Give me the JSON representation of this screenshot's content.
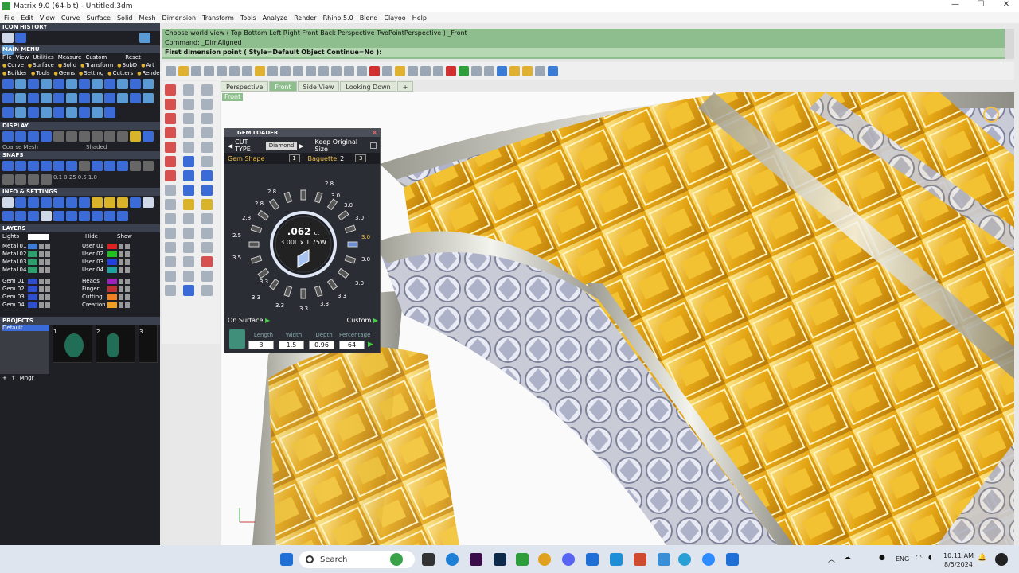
{
  "window": {
    "title": "Matrix 9.0 (64-bit) - Untitled.3dm",
    "controls": [
      "—",
      "☐",
      "✕"
    ]
  },
  "menubar": [
    "File",
    "Edit",
    "View",
    "Curve",
    "Surface",
    "Solid",
    "Mesh",
    "Dimension",
    "Transform",
    "Tools",
    "Analyze",
    "Render",
    "Rhino 5.0",
    "Blend",
    "Clayoo",
    "Help"
  ],
  "left_panel": {
    "icon_history": "ICON HISTORY",
    "main_menu": "MAIN MENU",
    "main_menu_items": [
      "File",
      "View",
      "Utilities",
      "Measure",
      "Custom",
      "Reset"
    ],
    "category_row1": [
      "Curve",
      "Surface",
      "Solid",
      "Transform",
      "SubD",
      "Art"
    ],
    "category_row2": [
      "Builder",
      "Tools",
      "Gems",
      "Setting",
      "Cutters",
      "Render"
    ],
    "display": "DISPLAY",
    "display_modes": [
      "Coarse Mesh",
      "Shaded"
    ],
    "snaps": "SNAPS",
    "snap_values": [
      "0.1",
      "0.25",
      "0.5",
      "1.0"
    ],
    "info_settings": "INFO & SETTINGS",
    "layers": "LAYERS",
    "layer_header": [
      "Lights",
      "Hide",
      "Show"
    ],
    "layers_left": [
      {
        "name": "Metal 01",
        "color": "#3a7bd5"
      },
      {
        "name": "Metal 02",
        "color": "#2e9e6c"
      },
      {
        "name": "Metal 03",
        "color": "#2e9e6c"
      },
      {
        "name": "Metal 04",
        "color": "#2e9e6c"
      },
      {
        "name": "Gem 01",
        "color": "#2f4fd0"
      },
      {
        "name": "Gem 02",
        "color": "#2f4fd0"
      },
      {
        "name": "Gem 03",
        "color": "#2f4fd0"
      },
      {
        "name": "Gem 04",
        "color": "#2f4fd0"
      }
    ],
    "layers_right": [
      {
        "name": "User 01",
        "color": "#e02020"
      },
      {
        "name": "User 02",
        "color": "#20c020"
      },
      {
        "name": "User 03",
        "color": "#2040e0"
      },
      {
        "name": "User 04",
        "color": "#20a0a0"
      },
      {
        "name": "Heads",
        "color": "#a020c0"
      },
      {
        "name": "Finger",
        "color": "#c03030"
      },
      {
        "name": "Cutting",
        "color": "#f08020"
      },
      {
        "name": "Creation",
        "color": "#f0a020"
      }
    ],
    "projects": "PROJECTS",
    "project_default": "Default",
    "project_thumbs": [
      "1",
      "2",
      "3"
    ],
    "mngr": "Mngr"
  },
  "command": {
    "line1": "Choose world view ( Top  Bottom  Left  Right  Front  Back  Perspective  TwoPointPerspective )  _Front",
    "line2": "Command: _DimAligned",
    "prompt": "First dimension point ( Style=Default  Object  Continue=No ):"
  },
  "viewport_tabs": [
    "Perspective",
    "Front",
    "Side View",
    "Looking Down",
    "+"
  ],
  "active_tab": "Front",
  "viewport_label": "Front",
  "gem_loader": {
    "title": "GEM LOADER",
    "cut_type_label": "CUT TYPE",
    "cut_type_value": "Diamond",
    "keep_original": "Keep Original Size",
    "gem_shape_label": "Gem Shape",
    "gem_shape_num": "1",
    "shape_name": "Baguette",
    "shape_num_a": "2",
    "shape_num_b": "3",
    "carat": ".062",
    "carat_unit": "ct",
    "size": "3.00L x 1.75W",
    "dial_labels_left": [
      "2.8",
      "2.8",
      "2.8",
      "2.5",
      "3.5",
      "3.3",
      "3.3",
      "3.3"
    ],
    "dial_labels_right": [
      "2.8",
      "3.0",
      "3.0",
      "3.0",
      "3.0",
      "3.0",
      "3.0",
      "3.3",
      "3.3",
      "3.3"
    ],
    "on_surface": "On Surface",
    "custom": "Custom",
    "dim_labels": [
      "Length",
      "Width",
      "Depth",
      "Percentage"
    ],
    "dim_values": [
      "3",
      "1.5",
      "0.96",
      "64"
    ]
  },
  "taskbar": {
    "search": "Search",
    "lang": "ENG",
    "time": "10:11 AM",
    "date": "8/5/2024"
  }
}
